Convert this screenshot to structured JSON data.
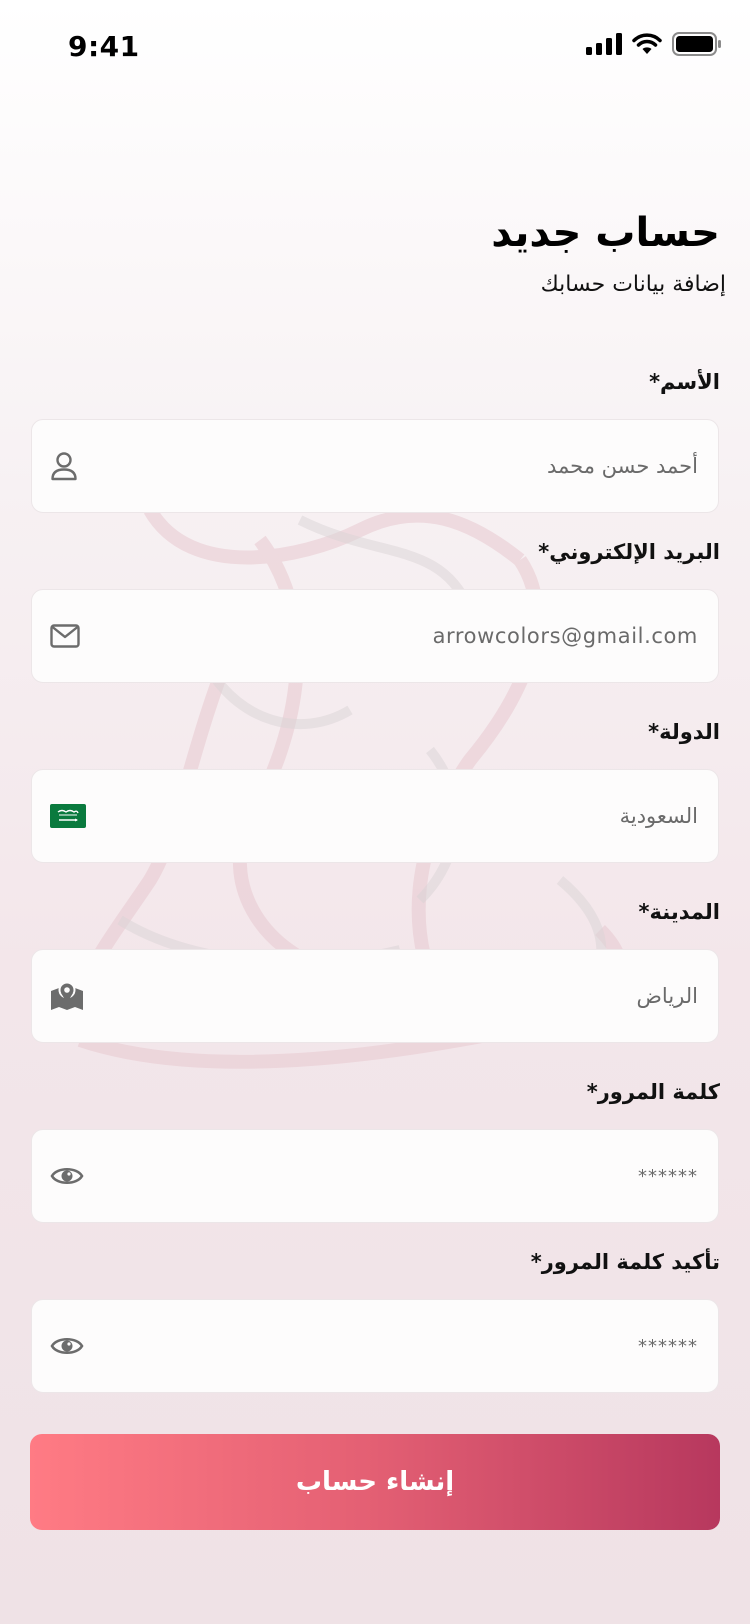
{
  "status_bar": {
    "time": "9:41",
    "icons": [
      "signal-icon",
      "wifi-icon",
      "battery-icon"
    ]
  },
  "header": {
    "title": "حساب جديد",
    "subtitle": "إضافة بيانات حسابك"
  },
  "form": {
    "name": {
      "label": "الأسم*",
      "value": "أحمد حسن محمد",
      "icon": "user-icon"
    },
    "email": {
      "label": "البريد الإلكتروني*",
      "value": "arrowcolors@gmail.com",
      "icon": "mail-icon"
    },
    "country": {
      "label": "الدولة*",
      "value": "السعودية",
      "icon": "saudi-flag-icon"
    },
    "city": {
      "label": "المدينة*",
      "value": "الرياض",
      "icon": "map-icon"
    },
    "password": {
      "label": "كلمة المرور*",
      "value": "******",
      "icon": "eye-icon"
    },
    "confirm_password": {
      "label": "تأكيد كلمة المرور*",
      "value": "******",
      "icon": "eye-icon"
    }
  },
  "submit": {
    "label": "إنشاء حساب"
  },
  "colors": {
    "button_start": "#ff7b84",
    "button_end": "#b7385e",
    "flag_green": "#0a7a3e"
  }
}
